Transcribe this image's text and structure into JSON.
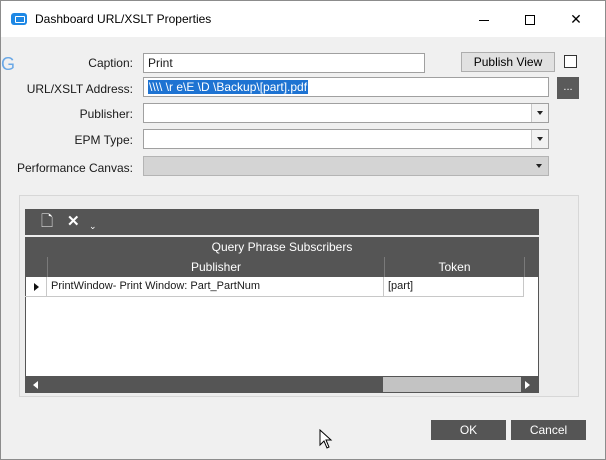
{
  "window": {
    "title": "Dashboard URL/XSLT Properties"
  },
  "form": {
    "caption_label": "Caption:",
    "caption_value": "Print",
    "publish_view_label": "Publish View",
    "url_label": "URL/XSLT Address:",
    "url_value": "\\\\\\\\  \\r    e\\E  \\D        \\Backup\\[part].pdf",
    "browse_label": "...",
    "publisher_label": "Publisher:",
    "publisher_value": "",
    "epm_type_label": "EPM Type:",
    "epm_type_value": "",
    "performance_canvas_label": "Performance Canvas:",
    "performance_canvas_value": ""
  },
  "grid": {
    "title": "Query Phrase Subscribers",
    "columns": [
      "Publisher",
      "Token"
    ],
    "rows": [
      {
        "publisher": "PrintWindow- Print Window: Part_PartNum",
        "token": "[part]"
      }
    ]
  },
  "buttons": {
    "ok": "OK",
    "cancel": "Cancel"
  },
  "icons": {
    "app": "app-icon",
    "new": "new-document-icon",
    "delete": "delete-x-icon",
    "dropdown": "chevron-down-icon"
  },
  "colors": {
    "toolbar": "#555555",
    "selection": "#1e73d2",
    "app_icon": "#1e88e5"
  }
}
